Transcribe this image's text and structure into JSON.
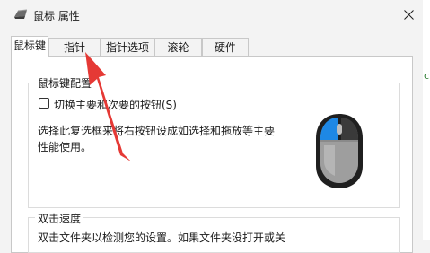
{
  "window": {
    "title": "鼠标 属性",
    "close_icon": "close-icon",
    "title_icon": "mouse-title-icon"
  },
  "tabs": [
    {
      "label": "鼠标键",
      "active": true
    },
    {
      "label": "指针",
      "active": false
    },
    {
      "label": "指针选项",
      "active": false
    },
    {
      "label": "滚轮",
      "active": false
    },
    {
      "label": "硬件",
      "active": false
    }
  ],
  "button_config": {
    "group_title": "鼠标键配置",
    "checkbox_label": "切换主要和次要的按钮(S)",
    "checkbox_checked": false,
    "description": "选择此复选框来将右按钮设成如选择和拖放等主要性能使用。",
    "mouse_image_icon": "mouse-illustration-icon"
  },
  "double_click": {
    "group_title": "双击速度",
    "description": "双击文件夹以检测您的设置。如果文件夹没打开或关"
  },
  "annotation": {
    "arrow_color": "#e53935",
    "arrow_icon": "red-arrow-icon"
  },
  "accent_color": "#1e88e5"
}
